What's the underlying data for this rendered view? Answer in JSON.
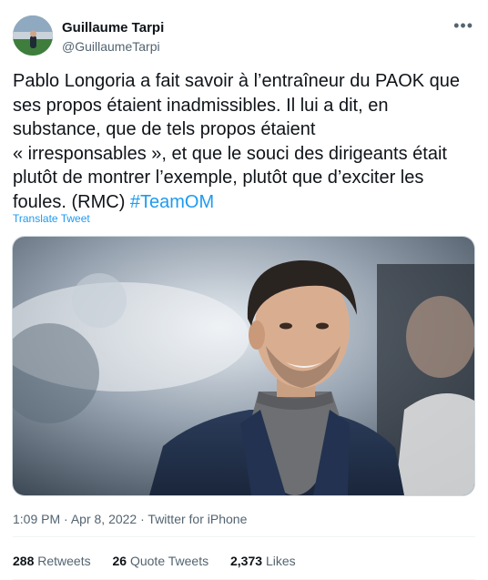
{
  "author": {
    "display_name": "Guillaume Tarpi",
    "handle": "@GuillaumeTarpi"
  },
  "more_icon": "more-horizontal-icon",
  "tweet": {
    "text": "Pablo Longoria a fait savoir à l’entraîneur du PAOK que\nses propos étaient inadmissibles. Il lui a dit, en\nsubstance, que de tels propos étaient\n« irresponsables », et que le souci des dirigeants était\nplutôt de montrer l’exemple, plutôt que d’exciter les\nfoules. (RMC) ",
    "hashtag": "#TeamOM",
    "translate_label": "Translate Tweet"
  },
  "meta": {
    "time": "1:09 PM",
    "date": "Apr 8, 2022",
    "source": "Twitter for iPhone",
    "separator": "·"
  },
  "stats": {
    "retweets_count": "288",
    "retweets_label": "Retweets",
    "quotes_count": "26",
    "quotes_label": "Quote Tweets",
    "likes_count": "2,373",
    "likes_label": "Likes"
  },
  "colors": {
    "link": "#1d9bf0",
    "secondary_text": "#536471",
    "primary_text": "#0f1419"
  }
}
